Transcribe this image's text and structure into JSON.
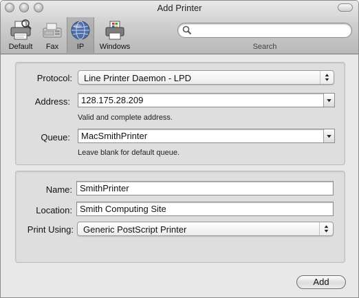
{
  "window": {
    "title": "Add Printer"
  },
  "toolbar": {
    "buttons": [
      {
        "label": "Default",
        "icon": "printer-icon"
      },
      {
        "label": "Fax",
        "icon": "fax-icon"
      },
      {
        "label": "IP",
        "icon": "globe-icon"
      },
      {
        "label": "Windows",
        "icon": "windows-printer-icon"
      }
    ],
    "selected": "IP",
    "search": {
      "placeholder": "",
      "label": "Search"
    }
  },
  "connection": {
    "protocol": {
      "label": "Protocol:",
      "value": "Line Printer Daemon - LPD"
    },
    "address": {
      "label": "Address:",
      "value": "128.175.28.209",
      "hint": "Valid and complete address."
    },
    "queue": {
      "label": "Queue:",
      "value": "MacSmithPrinter",
      "hint": "Leave blank for default queue."
    }
  },
  "details": {
    "name": {
      "label": "Name:",
      "value": "SmithPrinter"
    },
    "location": {
      "label": "Location:",
      "value": "Smith Computing Site"
    },
    "print_using": {
      "label": "Print Using:",
      "value": "Generic PostScript Printer"
    }
  },
  "actions": {
    "add_label": "Add"
  }
}
